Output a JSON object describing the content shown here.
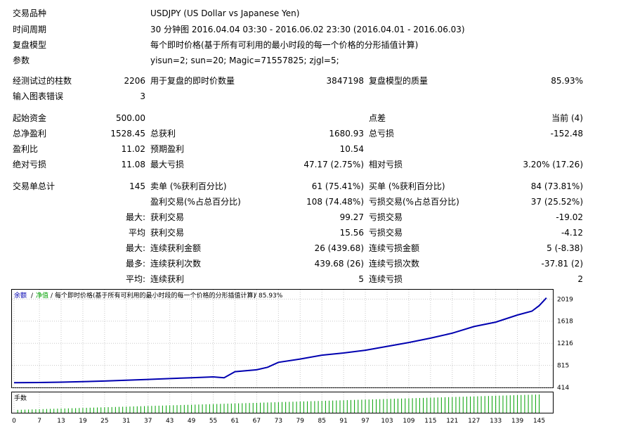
{
  "header": {
    "symbol": {
      "label": "交易品种",
      "value": "USDJPY (US Dollar vs Japanese Yen)"
    },
    "period": {
      "label": "时间周期",
      "value": "30 分钟图 2016.04.04 03:30 - 2016.06.02 23:30 (2016.04.01 - 2016.06.03)"
    },
    "model": {
      "label": "复盘模型",
      "value": "每个即时价格(基于所有可利用的最小时段的每一个价格的分形插值计算)"
    },
    "params": {
      "label": "参数",
      "value": "yisun=2; sun=20; Magic=71557825; zjgl=5;"
    }
  },
  "quality": {
    "bars_label": "经测试过的柱数",
    "bars_value": "2206",
    "ticks_label": "用于复盘的即时价数量",
    "ticks_value": "3847198",
    "quality_label": "复盘模型的质量",
    "quality_value": "85.93%",
    "errors_label": "输入图表错误",
    "errors_value": "3"
  },
  "stats": {
    "initial_deposit_label": "起始资金",
    "initial_deposit": "500.00",
    "spread_label": "点差",
    "spread_value": "当前 (4)",
    "net_profit_label": "总净盈利",
    "net_profit": "1528.45",
    "gross_profit_label": "总获利",
    "gross_profit": "1680.93",
    "gross_loss_label": "总亏损",
    "gross_loss": "-152.48",
    "profit_factor_label": "盈利比",
    "profit_factor": "11.02",
    "expected_payoff_label": "预期盈利",
    "expected_payoff": "10.54",
    "abs_drawdown_label": "绝对亏损",
    "abs_drawdown": "11.08",
    "max_drawdown_label": "最大亏损",
    "max_drawdown": "47.17 (2.75%)",
    "rel_drawdown_label": "相对亏损",
    "rel_drawdown": "3.20% (17.26)"
  },
  "trades": {
    "total_label": "交易单总计",
    "total": "145",
    "short_label": "卖单 (%获利百分比)",
    "short": "61 (75.41%)",
    "long_label": "买单 (%获利百分比)",
    "long": "84 (73.81%)",
    "profit_trades_label": "盈利交易(%占总百分比)",
    "profit_trades": "108 (74.48%)",
    "loss_trades_label": "亏损交易(%占总百分比)",
    "loss_trades": "37 (25.52%)",
    "largest_prefix": "最大:",
    "largest_profit_label": "获利交易",
    "largest_profit": "99.27",
    "largest_loss_label": "亏损交易",
    "largest_loss": "-19.02",
    "average_prefix": "平均",
    "average_profit_label": "获利交易",
    "average_profit": "15.56",
    "average_loss_label": "亏损交易",
    "average_loss": "-4.12",
    "max_prefix": "最大:",
    "max_consec_wins_label": "连续获利金额",
    "max_consec_wins": "26 (439.68)",
    "max_consec_losses_label": "连续亏损金额",
    "max_consec_losses": "5 (-8.38)",
    "most_prefix": "最多:",
    "max_consec_profit_label": "连续获利次数",
    "max_consec_profit": "439.68 (26)",
    "max_consec_loss_label": "连续亏损次数",
    "max_consec_loss": "-37.81 (2)",
    "avg_prefix": "平均:",
    "avg_consec_wins_label": "连续获利",
    "avg_consec_wins": "5",
    "avg_consec_losses_label": "连续亏损",
    "avg_consec_losses": "2"
  },
  "colors": {
    "balance": "#0000b0",
    "equity": "#00a000",
    "volume": "#00a000",
    "grid": "#c8c8c8"
  },
  "chart_data": {
    "type": "line",
    "legend": {
      "balance": "余额",
      "equity": "净值",
      "text": "每个即时价格(基于所有可利用的最小时段的每一个价格的分形插值计算)",
      "quality": "85.93%"
    },
    "volume_label": "手数",
    "y_ticks": [
      414,
      815,
      1216,
      1618,
      2019
    ],
    "ylim": [
      414,
      2100
    ],
    "x_ticks": [
      0,
      7,
      13,
      19,
      25,
      31,
      37,
      43,
      49,
      55,
      61,
      67,
      73,
      79,
      85,
      91,
      97,
      103,
      109,
      115,
      121,
      127,
      133,
      139,
      145
    ],
    "xlim": [
      0,
      148
    ],
    "series": [
      {
        "name": "余额",
        "x": [
          0,
          7,
          13,
          19,
          25,
          31,
          37,
          43,
          49,
          55,
          58,
          61,
          67,
          70,
          73,
          79,
          85,
          91,
          97,
          103,
          109,
          115,
          121,
          127,
          133,
          139,
          143,
          145,
          147
        ],
        "values": [
          500,
          504,
          510,
          520,
          530,
          545,
          560,
          575,
          590,
          605,
          590,
          700,
          735,
          780,
          870,
          930,
          1000,
          1040,
          1090,
          1160,
          1230,
          1310,
          1400,
          1520,
          1600,
          1730,
          1800,
          1900,
          2040
        ]
      }
    ]
  }
}
